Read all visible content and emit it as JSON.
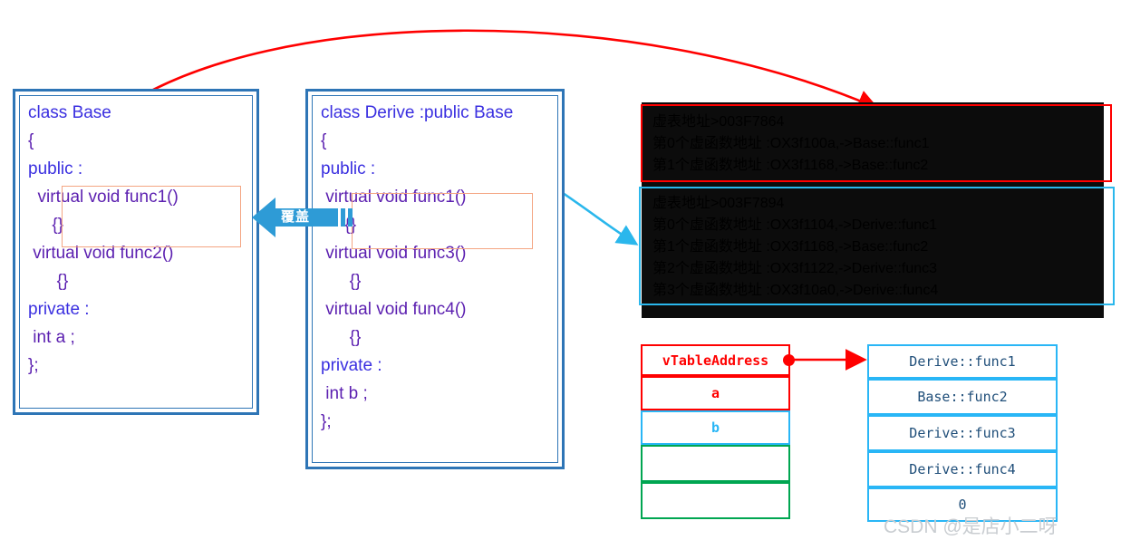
{
  "base_class": {
    "title": "class Base",
    "lines": [
      "class Base",
      "{",
      "public :",
      "  virtual void func1()",
      "     {}",
      " virtual void func2()",
      "      {}",
      "private :",
      " int a ;",
      "};"
    ],
    "highlight_label": "virtual void func1()"
  },
  "derive_class": {
    "title": "class Derive :public Base",
    "lines": [
      "class Derive :public Base",
      "{",
      "public :",
      " virtual void func1()",
      "     {}",
      " virtual void func3()",
      "      {}",
      " virtual void func4()",
      "      {}",
      "private :",
      " int b ;",
      "};"
    ],
    "highlight_label": "virtual void func1()"
  },
  "cover_arrow": {
    "label": "覆盖"
  },
  "console": {
    "base_output": {
      "lines": [
        "虚表地址>003F7864",
        "第0个虚函数地址 :OX3f100a,->Base::func1",
        "第1个虚函数地址 :OX3f1168,->Base::func2"
      ],
      "border_color": "#ff0000"
    },
    "derive_output": {
      "lines": [
        "虚表地址>003F7894",
        "第0个虚函数地址 :OX3f1104,->Derive::func1",
        "第1个虚函数地址 :OX3f1168,->Base::func2",
        "第2个虚函数地址 :OX3f1122,->Derive::func3",
        "第3个虚函数地址 :OX3f10a0,->Derive::func4"
      ],
      "border_color": "#2ab7ec"
    }
  },
  "object_layout": {
    "rows": [
      {
        "label": "vTableAddress",
        "color": "red"
      },
      {
        "label": "a",
        "color": "red"
      },
      {
        "label": "b",
        "color": "cyan"
      },
      {
        "label": "",
        "color": "green"
      },
      {
        "label": "",
        "color": "green"
      }
    ]
  },
  "vtable": {
    "rows": [
      {
        "label": "Derive::func1"
      },
      {
        "label": "Base::func2"
      },
      {
        "label": "Derive::func3"
      },
      {
        "label": "Derive::func4"
      },
      {
        "label": "0"
      }
    ]
  },
  "watermark": {
    "text": "CSDN @是店小二呀"
  },
  "colors": {
    "box_border": "#2e75b6",
    "code_keyword": "#3a2fe0",
    "code_ident": "#6b21c7",
    "highlight": "#f4a582",
    "red": "#ff0000",
    "cyan": "#29b6f6",
    "green": "#00a651",
    "console_bg": "#0c0c0c",
    "console_text": "#c8c8c8"
  }
}
